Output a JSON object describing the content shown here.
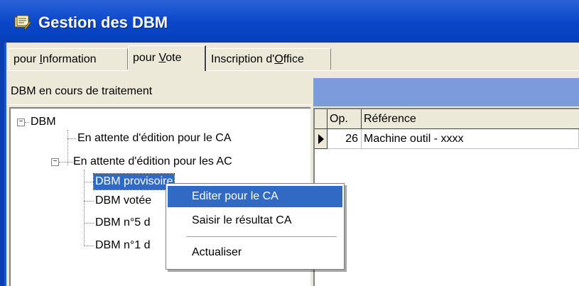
{
  "window": {
    "title": "Gestion des DBM"
  },
  "tabs": [
    {
      "pre": "pour ",
      "mnemonic": "I",
      "post": "nformation"
    },
    {
      "pre": "pour ",
      "mnemonic": "V",
      "post": "ote"
    },
    {
      "pre": "Inscription d'",
      "mnemonic": "O",
      "post": "ffice"
    }
  ],
  "left_panel": {
    "header": "DBM en cours de traitement",
    "tree": {
      "root": "DBM",
      "items": [
        "En attente d'édition pour le CA",
        "En attente d'édition pour les AC",
        "DBM provisoire",
        "DBM votée",
        "DBM n°5 d",
        "DBM n°1 d"
      ]
    }
  },
  "grid": {
    "columns": [
      "Op.",
      "Référence"
    ],
    "rows": [
      {
        "op": "26",
        "reference": "Machine outil  - xxxx"
      }
    ]
  },
  "context_menu": {
    "items": [
      "Editer pour le CA",
      "Saisir le résultat CA",
      "Actualiser"
    ]
  },
  "colors": {
    "titlebar": "#0a46c8",
    "selection": "#316ac5",
    "right_header": "#7b9bdc",
    "window_face": "#ece9d8"
  }
}
